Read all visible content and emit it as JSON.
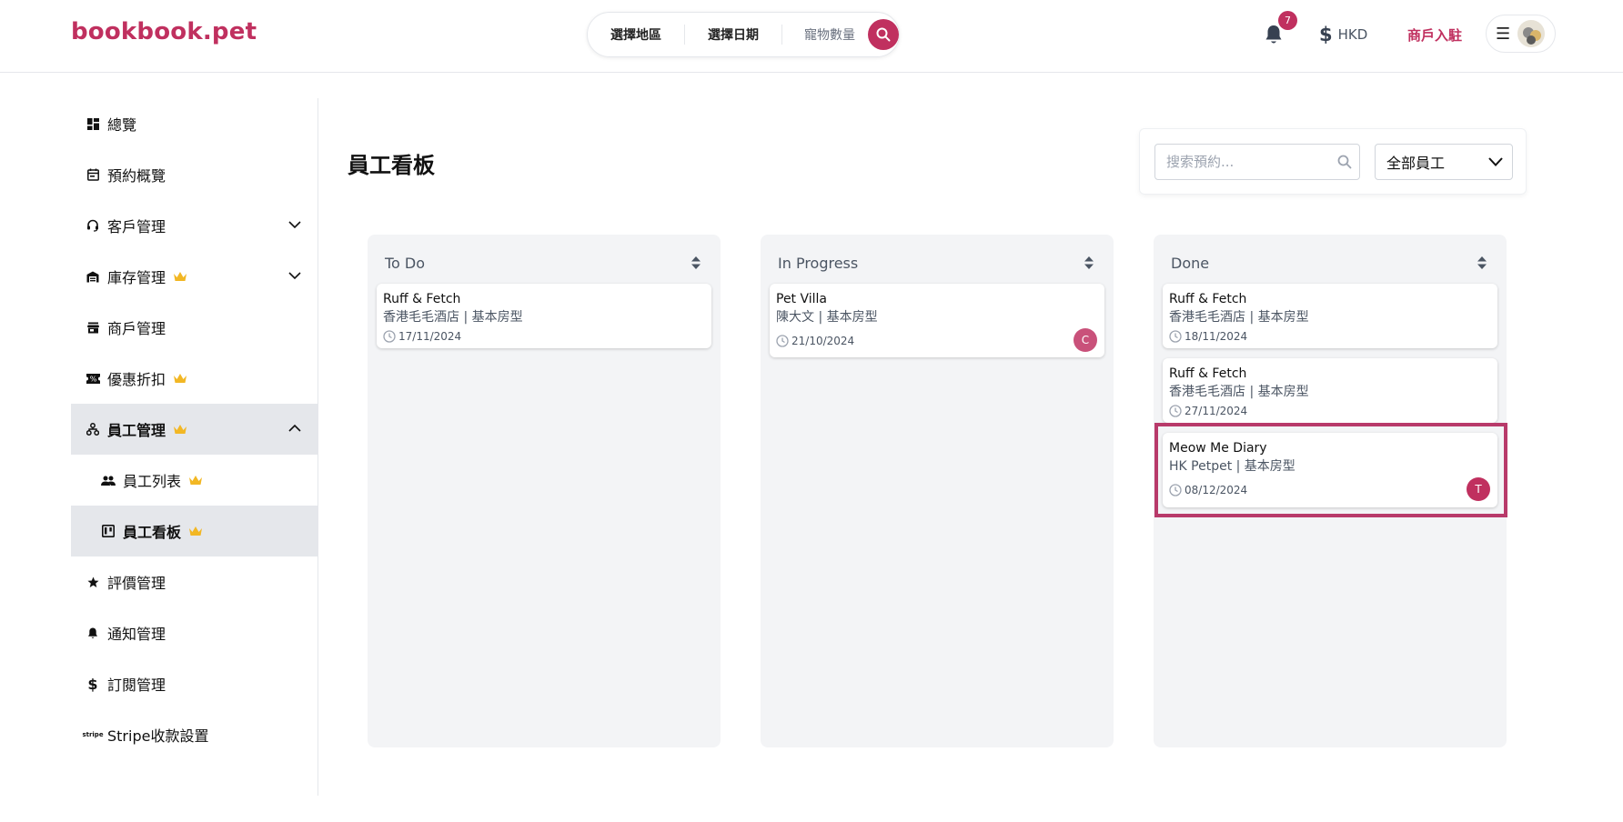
{
  "header": {
    "logo": "bookbook.pet",
    "search": {
      "region": "選擇地區",
      "date": "選擇日期",
      "pets": "寵物數量"
    },
    "notifications": {
      "count": "7"
    },
    "currency": "HKD",
    "merchant_link": "商戶入駐",
    "colors": {
      "brand": "#c0305f"
    }
  },
  "sidebar": {
    "items": [
      {
        "label": "總覽",
        "icon": "dashboard-icon"
      },
      {
        "label": "預約概覽",
        "icon": "calendar-icon"
      },
      {
        "label": "客戶管理",
        "icon": "headset-icon"
      },
      {
        "label": "庫存管理",
        "icon": "warehouse-icon"
      },
      {
        "label": "商戶管理",
        "icon": "store-icon"
      },
      {
        "label": "優惠折扣",
        "icon": "ticket-icon"
      },
      {
        "label": "員工管理",
        "icon": "org-chart-icon"
      },
      {
        "label": "員工列表",
        "icon": "people-icon"
      },
      {
        "label": "員工看板",
        "icon": "kanban-icon"
      },
      {
        "label": "評價管理",
        "icon": "star-icon"
      },
      {
        "label": "通知管理",
        "icon": "bell-icon"
      },
      {
        "label": "訂閱管理",
        "icon": "dollar-icon"
      },
      {
        "label": "Stripe收款設置",
        "icon": "stripe-icon"
      }
    ]
  },
  "main": {
    "title": "員工看板",
    "search_placeholder": "搜索預約...",
    "staff_filter": "全部員工"
  },
  "board": {
    "columns": [
      {
        "title": "To Do",
        "cards": [
          {
            "title": "Ruff & Fetch",
            "subtitle": "香港毛毛酒店 | 基本房型",
            "date": "17/11/2024"
          }
        ]
      },
      {
        "title": "In Progress",
        "cards": [
          {
            "title": "Pet Villa",
            "subtitle": "陳大文 | 基本房型",
            "date": "21/10/2024",
            "assignee": "C"
          }
        ]
      },
      {
        "title": "Done",
        "cards": [
          {
            "title": "Ruff & Fetch",
            "subtitle": "香港毛毛酒店 | 基本房型",
            "date": "18/11/2024"
          },
          {
            "title": "Ruff & Fetch",
            "subtitle": "香港毛毛酒店 | 基本房型",
            "date": "27/11/2024"
          },
          {
            "title": "Meow Me Diary",
            "subtitle": "HK Petpet | 基本房型",
            "date": "08/12/2024",
            "assignee": "T"
          }
        ]
      }
    ]
  }
}
